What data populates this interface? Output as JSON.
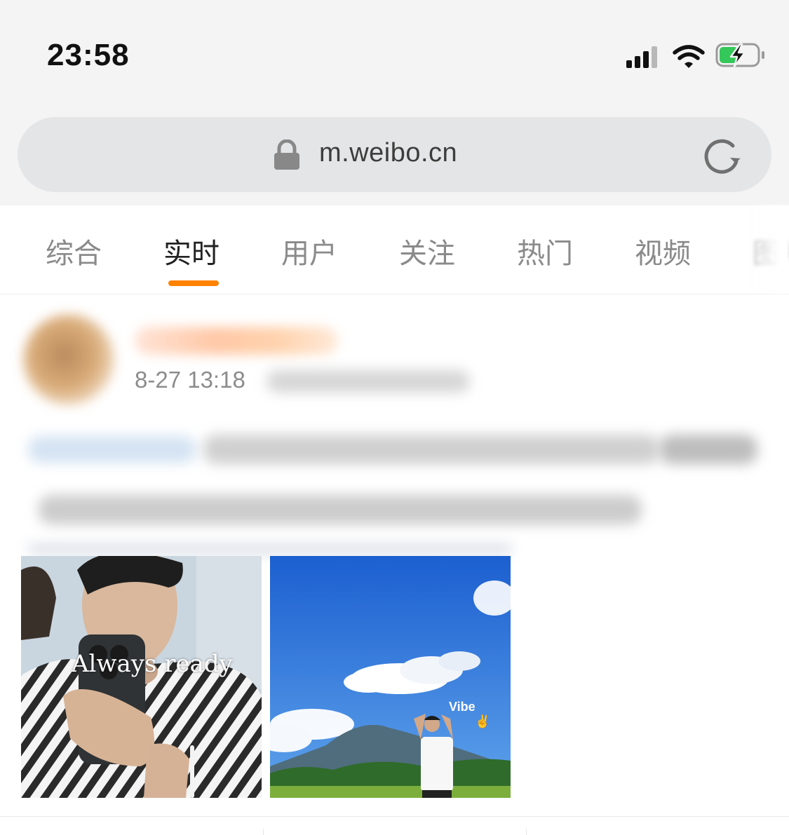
{
  "status_bar": {
    "time": "23:58",
    "icons": [
      "cellular-signal-icon",
      "wifi-icon",
      "battery-charging-icon"
    ],
    "battery_color": "#34c759"
  },
  "browser": {
    "url": "m.weibo.cn",
    "lock_icon": "lock-icon",
    "reload_icon": "reload-icon"
  },
  "tabs": {
    "items": [
      {
        "label": "综合"
      },
      {
        "label": "实时"
      },
      {
        "label": "用户"
      },
      {
        "label": "关注"
      },
      {
        "label": "热门"
      },
      {
        "label": "视频"
      },
      {
        "label": "图片"
      }
    ],
    "active_index": 1,
    "accent_color": "#ff8200"
  },
  "post": {
    "timestamp": "8-27 13:18",
    "images": [
      {
        "caption": "Always ready"
      },
      {
        "caption": "Vibe",
        "emoji": "✌"
      }
    ]
  }
}
